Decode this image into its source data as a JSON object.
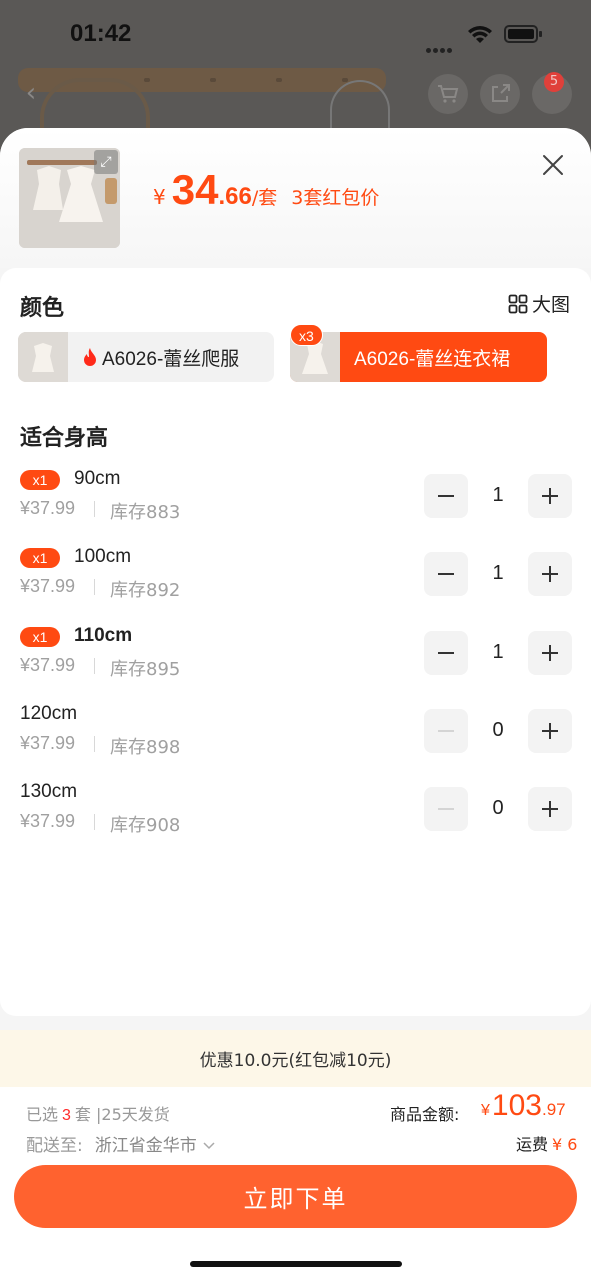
{
  "status_bar": {
    "time": "01:42"
  },
  "background": {
    "cart_badge": "5"
  },
  "header": {
    "price_currency": "¥",
    "price_int": "34",
    "price_dec": ".66",
    "price_unit": "/套",
    "price_note": "3套红包价"
  },
  "color_section": {
    "title": "颜色",
    "big_image_label": "大图",
    "options": [
      {
        "label": "A6026-蕾丝爬服",
        "hot": true,
        "selected": false
      },
      {
        "label": "A6026-蕾丝连衣裙",
        "count_badge": "x3",
        "selected": true
      }
    ]
  },
  "size_section": {
    "title": "适合身高",
    "sizes": [
      {
        "badge": "x1",
        "name": "90cm",
        "price": "¥37.99",
        "stock": "库存883",
        "qty": "1"
      },
      {
        "badge": "x1",
        "name": "100cm",
        "price": "¥37.99",
        "stock": "库存892",
        "qty": "1"
      },
      {
        "badge": "x1",
        "name": "110cm",
        "price": "¥37.99",
        "stock": "库存895",
        "qty": "1"
      },
      {
        "name": "120cm",
        "price": "¥37.99",
        "stock": "库存898",
        "qty": "0"
      },
      {
        "name": "130cm",
        "price": "¥37.99",
        "stock": "库存908",
        "qty": "0"
      }
    ]
  },
  "promo": {
    "text": "优惠10.0元(红包减10元)"
  },
  "footer": {
    "selected_prefix": "已选",
    "selected_count": "3",
    "selected_suffix": "套 |25天发货",
    "ship_label": "配送至:",
    "ship_location": "浙江省金华市",
    "total_label": "商品金额:",
    "total_currency": "¥",
    "total_int": "103",
    "total_dec": ".97",
    "freight_label": "运费",
    "freight_value": "¥ 6",
    "order_button": "立即下单"
  },
  "colors": {
    "accent": "#ff4a12",
    "button": "#ff622f",
    "promo_bg": "#fdf7e8"
  }
}
